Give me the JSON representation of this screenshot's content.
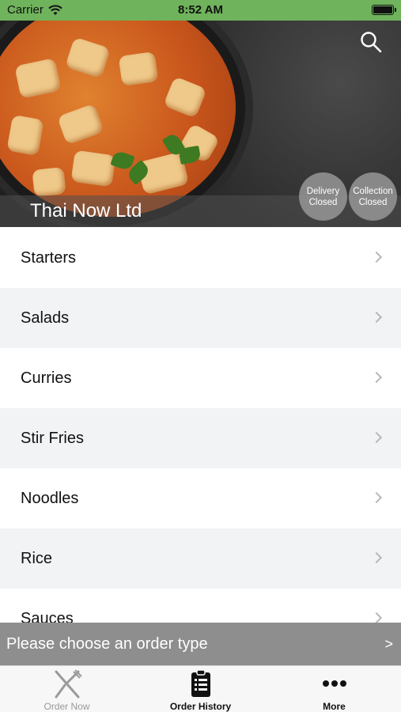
{
  "status_bar": {
    "carrier": "Carrier",
    "time": "8:52 AM",
    "color": "#6fb35c"
  },
  "hero": {
    "restaurant_name": "Thai Now Ltd",
    "search_icon": "search-icon",
    "badges": {
      "delivery": {
        "line1": "Delivery",
        "line2": "Closed"
      },
      "collection": {
        "line1": "Collection",
        "line2": "Closed"
      }
    }
  },
  "menu": {
    "items": [
      {
        "label": "Starters"
      },
      {
        "label": "Salads"
      },
      {
        "label": "Curries"
      },
      {
        "label": "Stir Fries"
      },
      {
        "label": "Noodles"
      },
      {
        "label": "Rice"
      },
      {
        "label": "Sauces"
      }
    ]
  },
  "order_bar": {
    "label": "Please choose an order type",
    "arrow": ">"
  },
  "tab_bar": {
    "tabs": [
      {
        "label": "Order Now",
        "icon": "fork-knife-icon",
        "active": false
      },
      {
        "label": "Order History",
        "icon": "clipboard-list-icon",
        "active": true
      },
      {
        "label": "More",
        "icon": "more-dots-icon",
        "active": true
      }
    ]
  }
}
